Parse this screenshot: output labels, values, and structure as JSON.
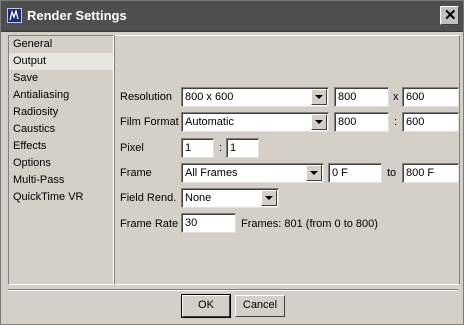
{
  "window": {
    "title": "Render Settings"
  },
  "sidebar": {
    "items": [
      {
        "label": "General"
      },
      {
        "label": "Output",
        "selected": true
      },
      {
        "label": "Save"
      },
      {
        "label": "Antialiasing"
      },
      {
        "label": "Radiosity"
      },
      {
        "label": "Caustics"
      },
      {
        "label": "Effects"
      },
      {
        "label": "Options"
      },
      {
        "label": "Multi-Pass"
      },
      {
        "label": "QuickTime VR"
      }
    ]
  },
  "output": {
    "resolution": {
      "label": "Resolution",
      "preset": "800 x 600",
      "width": "800",
      "sep": "x",
      "height": "600"
    },
    "film_format": {
      "label": "Film Format",
      "preset": "Automatic",
      "width": "800",
      "sep": ":",
      "height": "600"
    },
    "pixel": {
      "label": "Pixel",
      "x": "1",
      "sep": ":",
      "y": "1"
    },
    "frame": {
      "label": "Frame",
      "preset": "All Frames",
      "from": "0 F",
      "sep": "to",
      "to": "800 F"
    },
    "field_rend": {
      "label": "Field Rend.",
      "value": "None"
    },
    "frame_rate": {
      "label": "Frame Rate",
      "value": "30",
      "info": "Frames: 801 (from 0 to 800)"
    }
  },
  "buttons": {
    "ok": "OK",
    "cancel": "Cancel"
  },
  "icons": {
    "app": "app-icon",
    "close": "close-icon",
    "dropdown": "chevron-down-icon"
  },
  "colors": {
    "titlebar": "#4e4e4e",
    "dialog": "#d4d0c8",
    "selected": "#e8e6e1"
  }
}
